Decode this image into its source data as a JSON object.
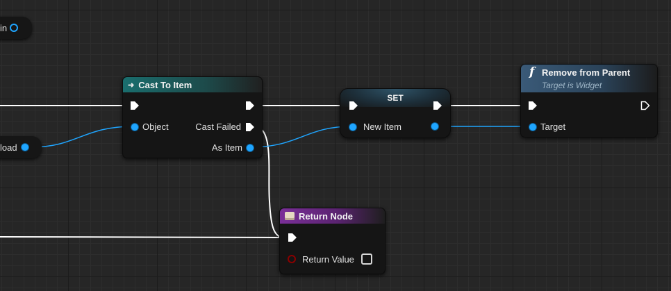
{
  "graph": {
    "left_nodes": {
      "top_partial_label": "in",
      "mid_partial_label": "load"
    },
    "cast_node": {
      "title": "Cast To Item",
      "object_pin": "Object",
      "cast_failed_pin": "Cast Failed",
      "as_item_pin": "As Item",
      "header_color": "#1a6e6e"
    },
    "set_node": {
      "title": "SET",
      "new_item_pin": "New Item"
    },
    "remove_node": {
      "title": "Remove from Parent",
      "subtitle": "Target is Widget",
      "target_pin": "Target",
      "icon": "function-icon",
      "header_color": "#2e4a63"
    },
    "return_node": {
      "title": "Return Node",
      "return_value_pin": "Return Value",
      "header_color": "#6a2a84"
    },
    "colors": {
      "exec_wire": "#ffffff",
      "object_pin": "#1fa5ff",
      "bool_pin": "#8b0000"
    }
  }
}
